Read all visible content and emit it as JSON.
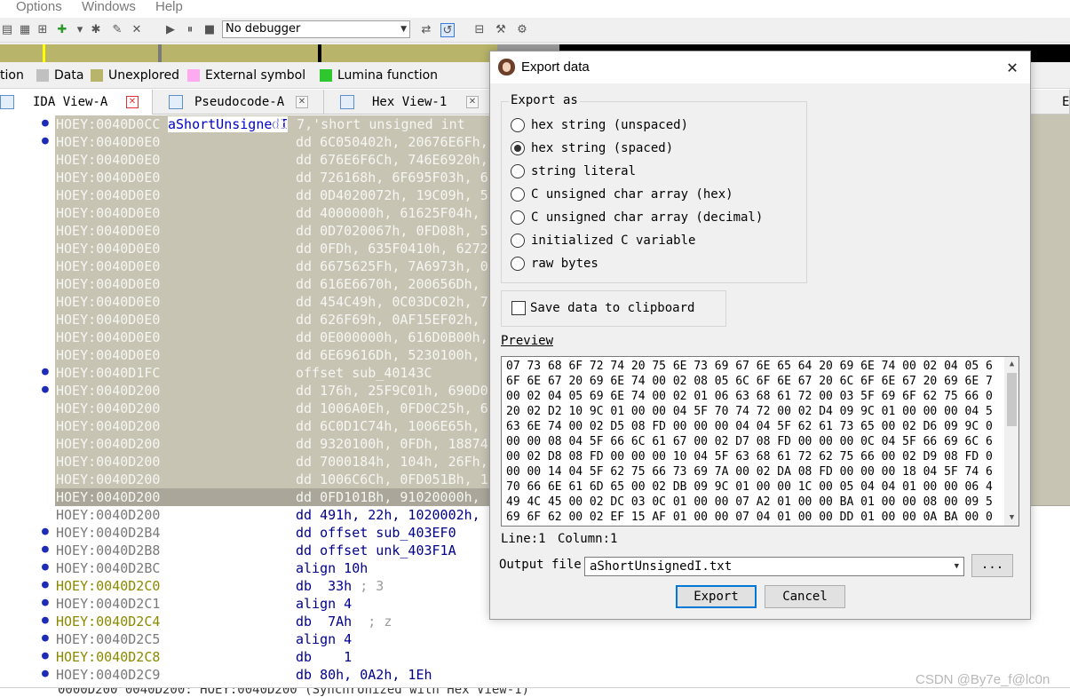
{
  "menubar": {
    "items": [
      "Options",
      "Windows",
      "Help"
    ]
  },
  "toolbar": {
    "debugger": "No debugger"
  },
  "legend": [
    {
      "label": "tion",
      "color": null
    },
    {
      "label": "Data",
      "color": "#c0c0c0"
    },
    {
      "label": "Unexplored",
      "color": "#b8b46a"
    },
    {
      "label": "External symbol",
      "color": "#ffaaf0"
    },
    {
      "label": "Lumina function",
      "color": "#2ec82e"
    }
  ],
  "tabs": [
    {
      "label": "IDA View-A"
    },
    {
      "label": "Pseudocode-A"
    },
    {
      "label": "Hex View-1"
    },
    {
      "label": "E"
    }
  ],
  "disasm": {
    "rows": [
      {
        "addr": "HOEY:0040D0CC",
        "label": "aShortUnsignedI",
        "instr": "db 7,'short unsigned int"
      },
      {
        "addr": "HOEY:0040D0E0",
        "instr": "dd 6C050402h, 20676E6Fh,"
      },
      {
        "addr": "HOEY:0040D0E0",
        "instr": "dd 676E6F6Ch, 746E6920h,"
      },
      {
        "addr": "HOEY:0040D0E0",
        "instr": "dd 726168h, 6F695F03h, 6"
      },
      {
        "addr": "HOEY:0040D0E0",
        "instr": "dd 0D4020072h, 19C09h, 5"
      },
      {
        "addr": "HOEY:0040D0E0",
        "instr": "dd 4000000h, 61625F04h,"
      },
      {
        "addr": "HOEY:0040D0E0",
        "instr": "dd 0D7020067h, 0FD08h, 5"
      },
      {
        "addr": "HOEY:0040D0E0",
        "instr": "dd 0FDh, 635F0410h, 6272"
      },
      {
        "addr": "HOEY:0040D0E0",
        "instr": "dd 6675625Fh, 7A6973h, 0"
      },
      {
        "addr": "HOEY:0040D0E0",
        "instr": "dd 616E6670h, 200656Dh,"
      },
      {
        "addr": "HOEY:0040D0E0",
        "instr": "dd 454C49h, 0C03DC02h, 7"
      },
      {
        "addr": "HOEY:0040D0E0",
        "instr": "dd 626F69h, 0AF15EF02h,"
      },
      {
        "addr": "HOEY:0040D0E0",
        "instr": "dd 0E000000h, 616D0B00h,"
      },
      {
        "addr": "HOEY:0040D0E0",
        "instr": "dd 6E69616Dh, 5230100h,"
      },
      {
        "addr": "HOEY:0040D1FC",
        "instr": "offset sub_40143C"
      },
      {
        "addr": "HOEY:0040D200",
        "instr": "dd 176h, 25F9C01h, 690D0"
      },
      {
        "addr": "HOEY:0040D200",
        "instr": "dd 1006A0Eh, 0FD0C25h, 6"
      },
      {
        "addr": "HOEY:0040D200",
        "instr": "dd 6C0D1C74h, 1006E65h,"
      },
      {
        "addr": "HOEY:0040D200",
        "instr": "dd 9320100h, 0FDh, 18874"
      },
      {
        "addr": "HOEY:0040D200",
        "instr": "dd 7000184h, 104h, 26Fh,"
      },
      {
        "addr": "HOEY:0040D200",
        "instr": "dd 1006C6Ch, 0FD051Bh, 1"
      },
      {
        "addr": "HOEY:0040D200",
        "instr": "dd 0FD101Bh, 91020000h,"
      },
      {
        "addr": "HOEY:0040D200",
        "instr": "dd 491h, 22h, 1020002h, 1"
      },
      {
        "addr": "HOEY:0040D2B4",
        "instr": "dd offset sub_403EF0"
      },
      {
        "addr": "HOEY:0040D2B8",
        "instr": "dd offset unk_403F1A"
      },
      {
        "addr": "HOEY:0040D2BC",
        "instr": "align 10h"
      },
      {
        "addr": "HOEY:0040D2C0",
        "instr": "db  33h",
        "comment": "; 3"
      },
      {
        "addr": "HOEY:0040D2C1",
        "instr": "align 4"
      },
      {
        "addr": "HOEY:0040D2C4",
        "instr": "db  7Ah",
        "comment": "; z"
      },
      {
        "addr": "HOEY:0040D2C5",
        "instr": "align 4"
      },
      {
        "addr": "HOEY:0040D2C8",
        "instr": "db    1"
      },
      {
        "addr": "HOEY:0040D2C9",
        "instr": "db 80h, 0A2h, 1Eh"
      }
    ]
  },
  "status_line": "0000D200 0040D200: HOEY:0040D200 (Synchronized with Hex View-1)",
  "watermark": "CSDN @By7e_f@lc0n",
  "dialog": {
    "title": "Export data",
    "export_as_label": "Export as",
    "options": [
      {
        "label": "hex string (unspaced)",
        "checked": false
      },
      {
        "label": "hex string (spaced)",
        "checked": true
      },
      {
        "label": "string literal",
        "checked": false
      },
      {
        "label": "C unsigned char array (hex)",
        "checked": false
      },
      {
        "label": "C unsigned char array (decimal)",
        "checked": false
      },
      {
        "label": "initialized C variable",
        "checked": false
      },
      {
        "label": "raw bytes",
        "checked": false
      }
    ],
    "clipboard_label": "Save data to clipboard",
    "clipboard_checked": false,
    "preview_label": "Preview",
    "preview_lines": [
      "07 73 68 6F 72 74 20 75 6E 73 69 67 6E 65 64 20 69 6E 74 00 02 04 05 6",
      "6F 6E 67 20 69 6E 74 00 02 08 05 6C 6F 6E 67 20 6C 6F 6E 67 20 69 6E 7",
      "00 02 04 05 69 6E 74 00 02 01 06 63 68 61 72 00 03 5F 69 6F 62 75 66 0",
      "20 02 D2 10 9C 01 00 00 04 5F 70 74 72 00 02 D4 09 9C 01 00 00 00 04 5",
      "63 6E 74 00 02 D5 08 FD 00 00 00 04 04 5F 62 61 73 65 00 02 D6 09 9C 0",
      "00 00 08 04 5F 66 6C 61 67 00 02 D7 08 FD 00 00 00 0C 04 5F 66 69 6C 6",
      "00 02 D8 08 FD 00 00 00 10 04 5F 63 68 61 72 62 75 66 00 02 D9 08 FD 0",
      "00 00 14 04 5F 62 75 66 73 69 7A 00 02 DA 08 FD 00 00 00 18 04 5F 74 6",
      "70 66 6E 61 6D 65 00 02 DB 09 9C 01 00 00 1C 00 05 04 04 01 00 00 06 4",
      "49 4C 45 00 02 DC 03 0C 01 00 00 07 A2 01 00 00 BA 01 00 00 08 00 09 5",
      "69 6F 62 00 02 EF 15 AF 01 00 00 07 04 01 00 00 DD 01 00 00 0A BA 00 0"
    ],
    "line_label": "Line:1",
    "column_label": "Column:1",
    "output_file_label": "Output file",
    "output_file_value": "aShortUnsignedI.txt",
    "browse_label": "...",
    "export_button": "Export",
    "cancel_button": "Cancel"
  }
}
